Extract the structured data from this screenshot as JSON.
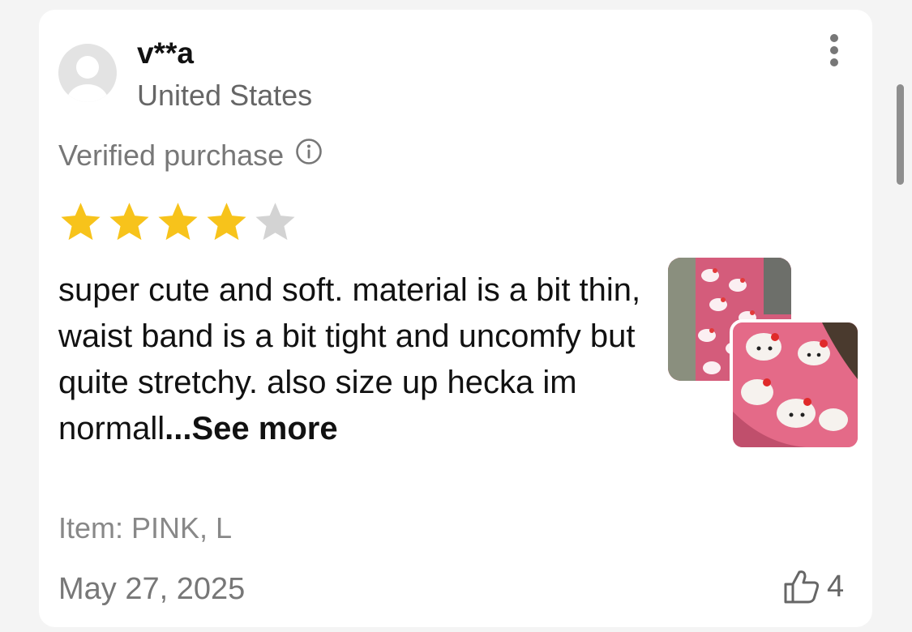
{
  "review": {
    "username": "v**a",
    "country": "United States",
    "verified_label": "Verified purchase",
    "rating": 4,
    "rating_max": 5,
    "text": "super cute and soft. material is a bit thin, waist band is a bit tight and uncomfy but quite stretchy. also size up hecka im normall",
    "see_more_label": "...See more",
    "item_label": "Item: PINK, L",
    "date": "May 27, 2025",
    "helpful_count": "4"
  },
  "icons": {
    "avatar": "default-user-avatar",
    "info": "info-circle-icon",
    "menu": "vertical-ellipsis-icon",
    "star_filled": "star-filled-icon",
    "star_empty": "star-empty-icon",
    "like": "thumbs-up-icon"
  },
  "colors": {
    "star_filled": "#F7C31B",
    "star_empty": "#D3D3D3",
    "text_primary": "#111111",
    "text_secondary": "#777777"
  }
}
